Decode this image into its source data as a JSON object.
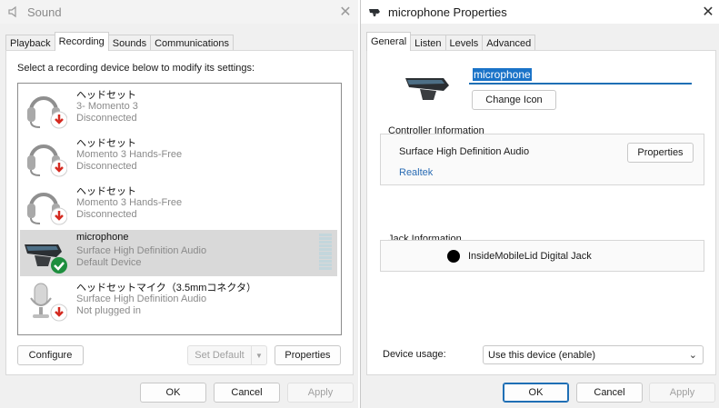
{
  "sound": {
    "title": "Sound",
    "close": "✕",
    "tabs": [
      "Playback",
      "Recording",
      "Sounds",
      "Communications"
    ],
    "instructions": "Select a recording device below to modify its settings:",
    "devices": [
      {
        "name": "ヘッドセット",
        "line1": "3- Momento 3",
        "line2": "Disconnected",
        "icon": "headset-disconnected-icon"
      },
      {
        "name": "ヘッドセット",
        "line1": "Momento 3 Hands-Free",
        "line2": "Disconnected",
        "icon": "headset-disconnected-icon"
      },
      {
        "name": "ヘッドセット",
        "line1": "Momento 3 Hands-Free",
        "line2": "Disconnected",
        "icon": "headset-disconnected-icon"
      },
      {
        "name": "microphone",
        "line1": "Surface High Definition Audio",
        "line2": "Default Device",
        "icon": "microphone-default-icon",
        "selected": true
      },
      {
        "name": "ヘッドセットマイク（3.5mmコネクタ）",
        "line1": "Surface High Definition Audio",
        "line2": "Not plugged in",
        "icon": "headset-mic-unplugged-icon"
      }
    ],
    "buttons": {
      "configure": "Configure",
      "set_default": "Set Default",
      "properties": "Properties",
      "ok": "OK",
      "cancel": "Cancel",
      "apply": "Apply"
    }
  },
  "props": {
    "title": "microphone Properties",
    "close": "✕",
    "tabs": [
      "General",
      "Listen",
      "Levels",
      "Advanced"
    ],
    "device_name": "microphone",
    "change_icon": "Change Icon",
    "controller": {
      "title": "Controller Information",
      "name": "Surface High Definition Audio",
      "vendor": "Realtek",
      "properties": "Properties"
    },
    "jack": {
      "title": "Jack Information",
      "name": "InsideMobileLid Digital Jack"
    },
    "device_usage": {
      "label": "Device usage:",
      "value": "Use this device (enable)"
    },
    "buttons": {
      "ok": "OK",
      "cancel": "Cancel",
      "apply": "Apply"
    }
  },
  "colors": {
    "accent": "#1f6fb5",
    "link": "#2a6cb4",
    "error_badge": "#d42a20",
    "ok_badge": "#1e8e3e"
  }
}
